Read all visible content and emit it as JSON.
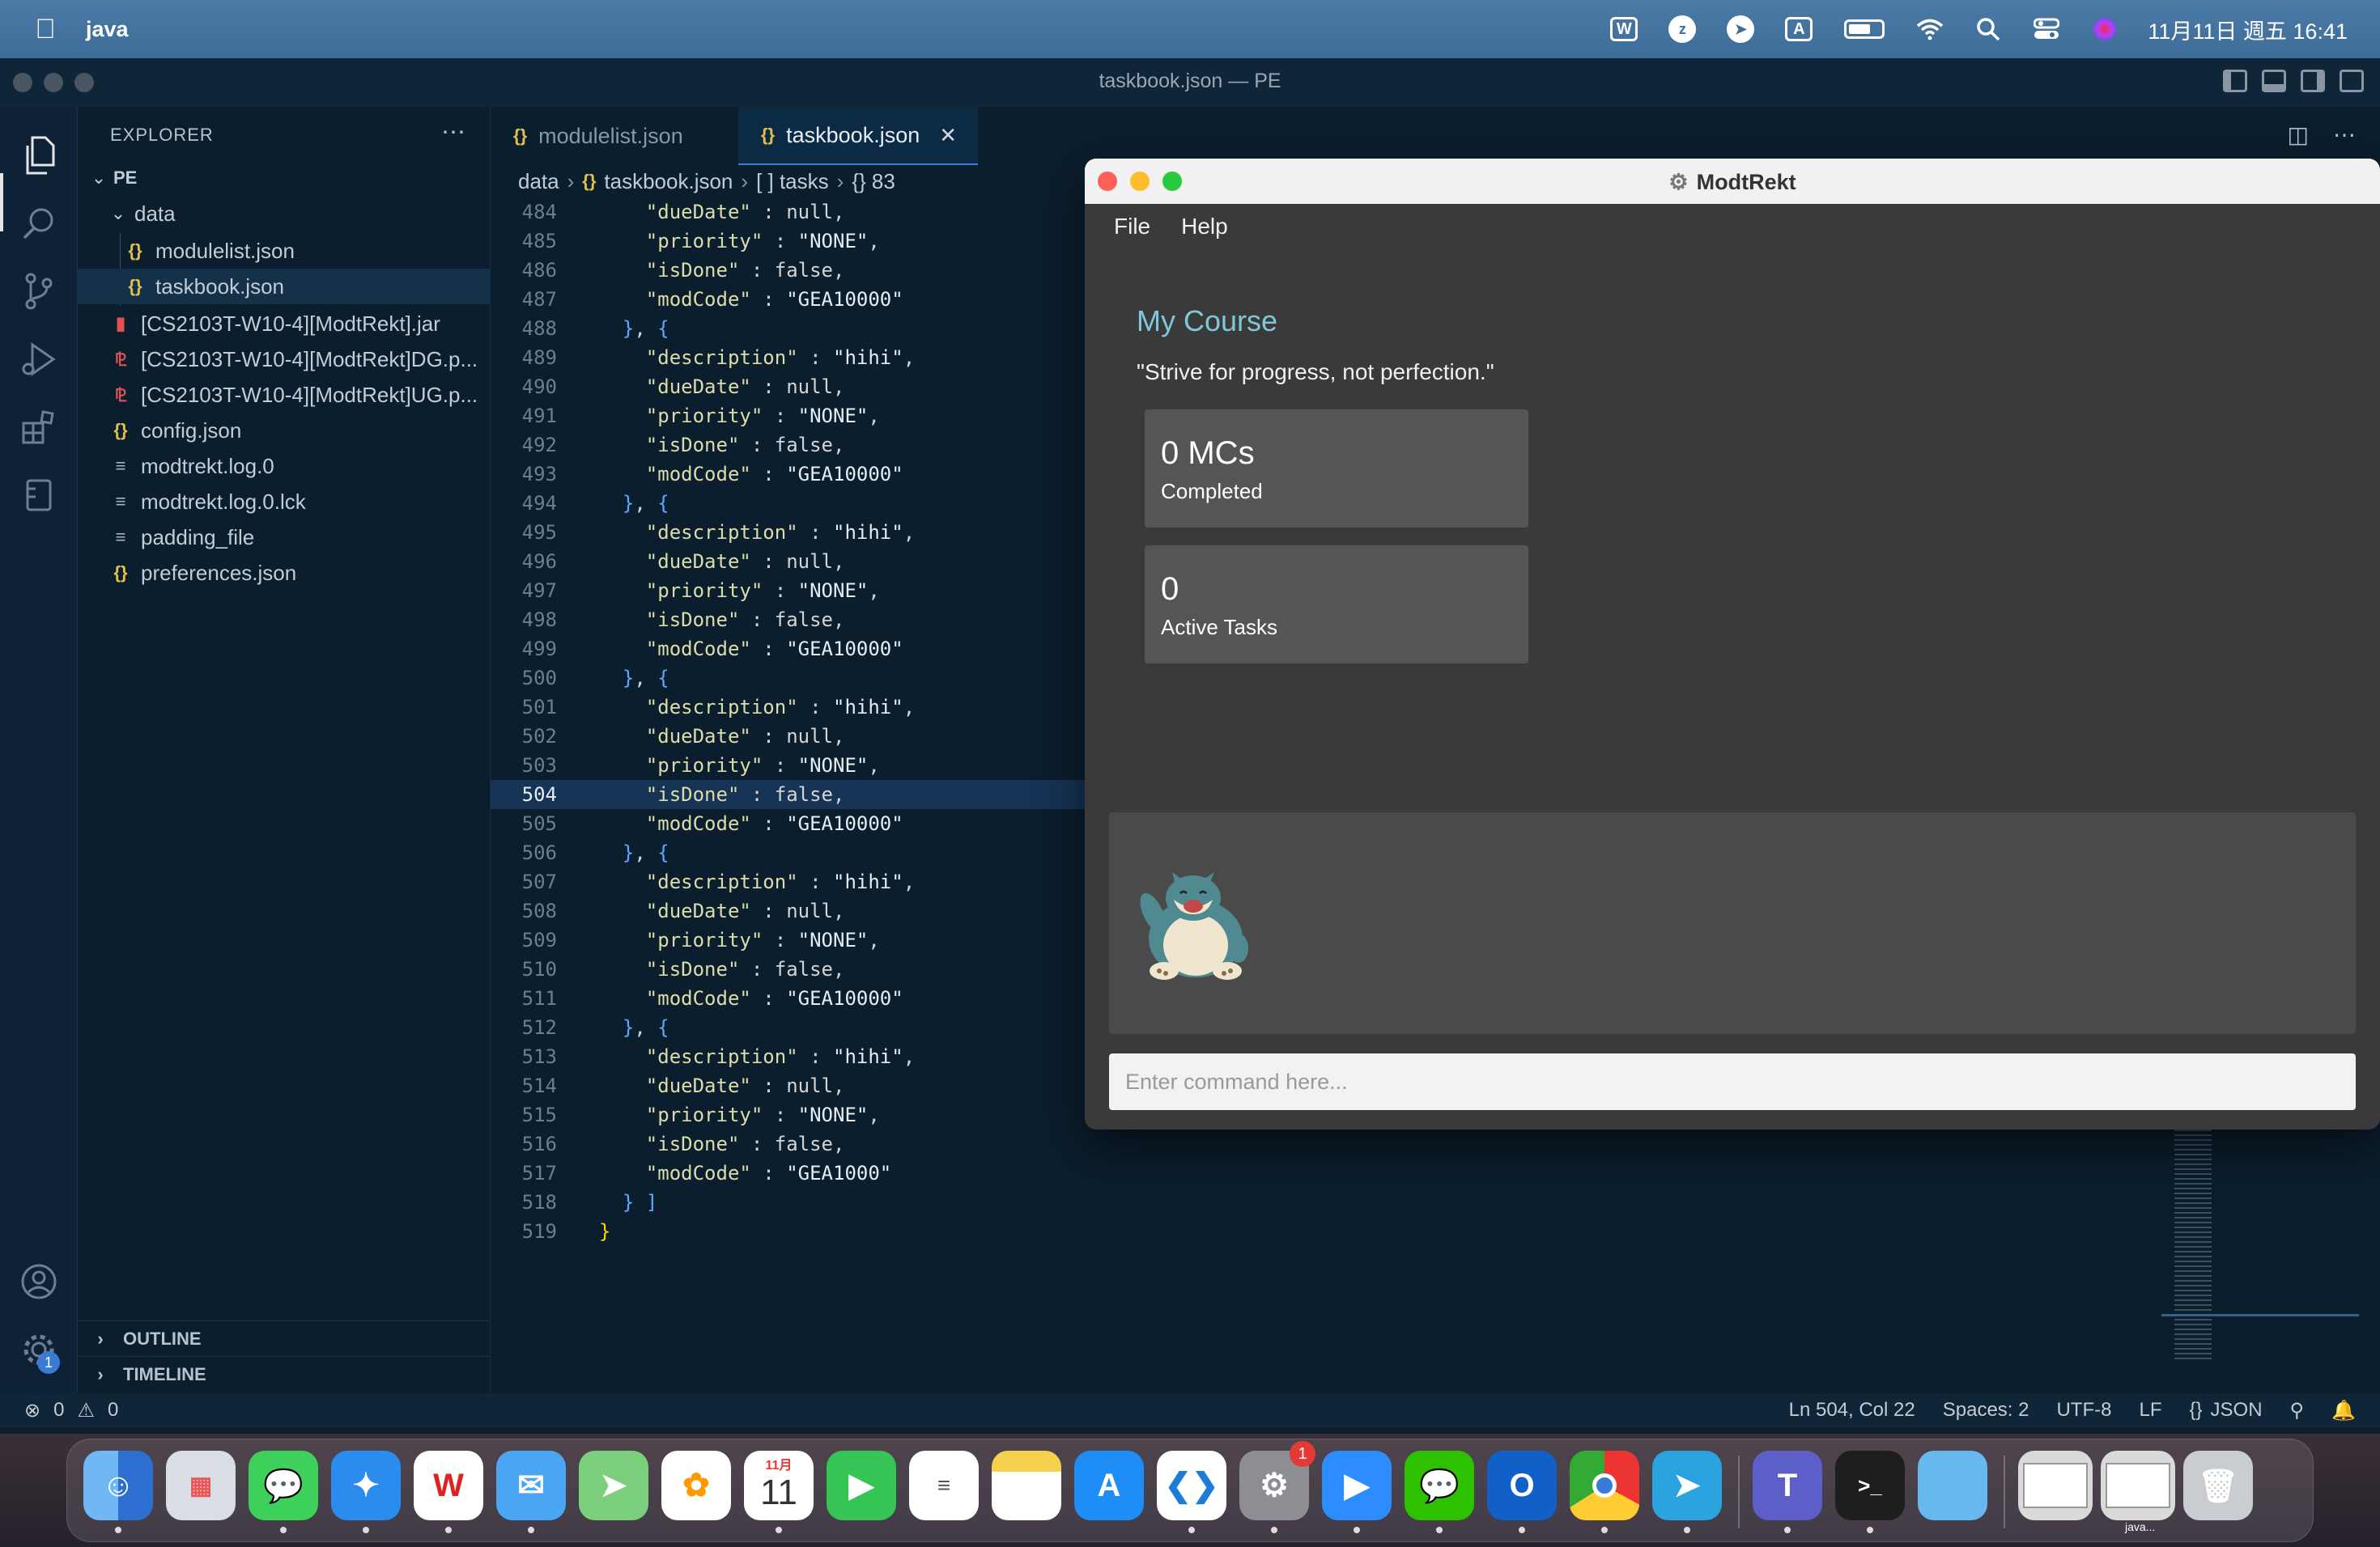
{
  "menubar": {
    "app_name": "java",
    "clock": "11月11日 週五 16:41",
    "status_icons": [
      "wps-icon",
      "zoom-icon",
      "telegram-icon",
      "input-method-icon",
      "battery-icon",
      "wifi-icon",
      "spotlight-icon",
      "control-center-icon",
      "siri-icon"
    ],
    "input_method_label": "A",
    "wps_label": "W"
  },
  "vscode": {
    "window_title": "taskbook.json — PE",
    "explorer": {
      "title": "EXPLORER",
      "root": "PE",
      "folder": "data",
      "items": [
        {
          "name": "modulelist.json",
          "type": "json"
        },
        {
          "name": "taskbook.json",
          "type": "json",
          "selected": true
        },
        {
          "name": "[CS2103T-W10-4][ModtRekt].jar",
          "type": "jar"
        },
        {
          "name": "[CS2103T-W10-4][ModtRekt]DG.p...",
          "type": "pdf"
        },
        {
          "name": "[CS2103T-W10-4][ModtRekt]UG.p...",
          "type": "pdf"
        },
        {
          "name": "config.json",
          "type": "json"
        },
        {
          "name": "modtrekt.log.0",
          "type": "log"
        },
        {
          "name": "modtrekt.log.0.lck",
          "type": "log"
        },
        {
          "name": "padding_file",
          "type": "log"
        },
        {
          "name": "preferences.json",
          "type": "json"
        }
      ],
      "sections": [
        "OUTLINE",
        "TIMELINE"
      ]
    },
    "tabs": [
      {
        "label": "modulelist.json",
        "active": false
      },
      {
        "label": "taskbook.json",
        "active": true
      }
    ],
    "breadcrumb": [
      "data",
      "taskbook.json",
      "[ ] tasks",
      "{} 83"
    ],
    "current_line": 504,
    "code": [
      {
        "n": 484,
        "t": "    \"dueDate\" : null,"
      },
      {
        "n": 485,
        "t": "    \"priority\" : \"NONE\","
      },
      {
        "n": 486,
        "t": "    \"isDone\" : false,"
      },
      {
        "n": 487,
        "t": "    \"modCode\" : \"GEA10000\""
      },
      {
        "n": 488,
        "t": "  }, {"
      },
      {
        "n": 489,
        "t": "    \"description\" : \"hihi\","
      },
      {
        "n": 490,
        "t": "    \"dueDate\" : null,"
      },
      {
        "n": 491,
        "t": "    \"priority\" : \"NONE\","
      },
      {
        "n": 492,
        "t": "    \"isDone\" : false,"
      },
      {
        "n": 493,
        "t": "    \"modCode\" : \"GEA10000\""
      },
      {
        "n": 494,
        "t": "  }, {"
      },
      {
        "n": 495,
        "t": "    \"description\" : \"hihi\","
      },
      {
        "n": 496,
        "t": "    \"dueDate\" : null,"
      },
      {
        "n": 497,
        "t": "    \"priority\" : \"NONE\","
      },
      {
        "n": 498,
        "t": "    \"isDone\" : false,"
      },
      {
        "n": 499,
        "t": "    \"modCode\" : \"GEA10000\""
      },
      {
        "n": 500,
        "t": "  }, {"
      },
      {
        "n": 501,
        "t": "    \"description\" : \"hihi\","
      },
      {
        "n": 502,
        "t": "    \"dueDate\" : null,"
      },
      {
        "n": 503,
        "t": "    \"priority\" : \"NONE\","
      },
      {
        "n": 504,
        "t": "    \"isDone\" : false,"
      },
      {
        "n": 505,
        "t": "    \"modCode\" : \"GEA10000\""
      },
      {
        "n": 506,
        "t": "  }, {"
      },
      {
        "n": 507,
        "t": "    \"description\" : \"hihi\","
      },
      {
        "n": 508,
        "t": "    \"dueDate\" : null,"
      },
      {
        "n": 509,
        "t": "    \"priority\" : \"NONE\","
      },
      {
        "n": 510,
        "t": "    \"isDone\" : false,"
      },
      {
        "n": 511,
        "t": "    \"modCode\" : \"GEA10000\""
      },
      {
        "n": 512,
        "t": "  }, {"
      },
      {
        "n": 513,
        "t": "    \"description\" : \"hihi\","
      },
      {
        "n": 514,
        "t": "    \"dueDate\" : null,"
      },
      {
        "n": 515,
        "t": "    \"priority\" : \"NONE\","
      },
      {
        "n": 516,
        "t": "    \"isDone\" : false,"
      },
      {
        "n": 517,
        "t": "    \"modCode\" : \"GEA1000\""
      },
      {
        "n": 518,
        "t": "  } ]"
      },
      {
        "n": 519,
        "t": "}"
      }
    ],
    "status": {
      "errors": "0",
      "warnings": "0",
      "position": "Ln 504, Col 22",
      "spaces": "Spaces: 2",
      "encoding": "UTF-8",
      "eol": "LF",
      "language": "JSON"
    },
    "settings_badge": "1"
  },
  "modtrekt": {
    "title": "ModtRekt",
    "menu": [
      "File",
      "Help"
    ],
    "course_title": "My Course",
    "quote": "\"Strive for progress, not perfection.\"",
    "cards": [
      {
        "number": "0 MCs",
        "label": "Completed"
      },
      {
        "number": "0",
        "label": "Active Tasks"
      }
    ],
    "command_placeholder": "Enter command here...",
    "colors": {
      "accent": "#7fc8d8",
      "background": "#3a3a3a",
      "card": "#555555"
    }
  },
  "dock": {
    "apps": [
      "finder-icon",
      "launchpad-icon",
      "messages-icon",
      "safari-icon",
      "wps-office-icon",
      "mail-icon",
      "maps-icon",
      "photos-icon",
      "calendar-icon",
      "facetime-icon",
      "reminders-icon",
      "notes-icon",
      "app-store-icon",
      "vscode-icon",
      "system-preferences-icon",
      "zoom-icon",
      "wechat-icon",
      "outlook-icon",
      "chrome-icon",
      "telegram-icon",
      "teams-icon",
      "terminal-icon",
      "folder-icon",
      "chrome-window-icon",
      "java-window-icon",
      "trash-icon"
    ],
    "calendar_month": "11月",
    "calendar_day": "11",
    "system_prefs_badge": "1",
    "java_window_label": "java..."
  }
}
